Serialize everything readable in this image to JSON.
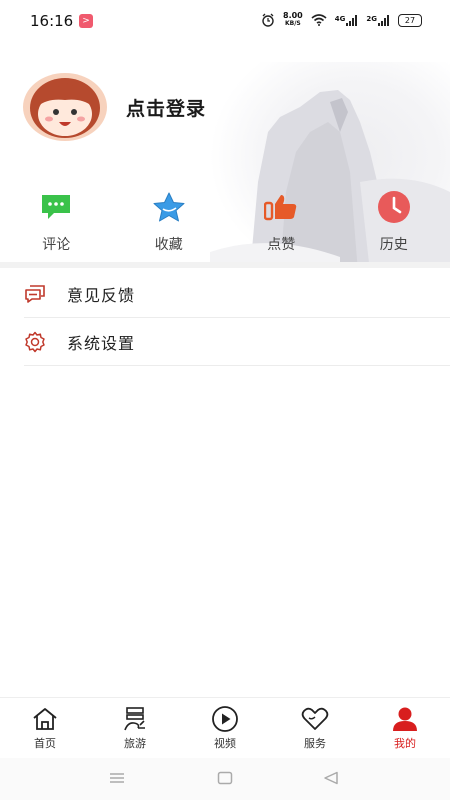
{
  "status_bar": {
    "time": "16:16",
    "notif_badge": ">",
    "net_speed_value": "8.00",
    "net_speed_unit": "KB/S",
    "signal1_label": "4G",
    "signal2_label": "2G",
    "battery": "27"
  },
  "profile": {
    "login_text": "点击登录"
  },
  "shortcuts": [
    {
      "label": "评论",
      "icon": "comment-icon",
      "color": "#3ac24a"
    },
    {
      "label": "收藏",
      "icon": "star-icon",
      "color": "#3a9be6"
    },
    {
      "label": "点赞",
      "icon": "thumbs-up-icon",
      "color": "#e65a28"
    },
    {
      "label": "历史",
      "icon": "clock-icon",
      "color": "#e85a5a"
    }
  ],
  "menu": [
    {
      "label": "意见反馈",
      "icon": "feedback-icon"
    },
    {
      "label": "系统设置",
      "icon": "settings-gear-icon"
    }
  ],
  "bottom_nav": [
    {
      "label": "首页",
      "icon": "home-icon",
      "active": false
    },
    {
      "label": "旅游",
      "icon": "travel-icon",
      "active": false
    },
    {
      "label": "视频",
      "icon": "video-play-icon",
      "active": false
    },
    {
      "label": "服务",
      "icon": "heart-icon",
      "active": false
    },
    {
      "label": "我的",
      "icon": "person-icon",
      "active": true
    }
  ],
  "colors": {
    "accent_active": "#d81e1e",
    "menu_icon": "#c0392b"
  }
}
